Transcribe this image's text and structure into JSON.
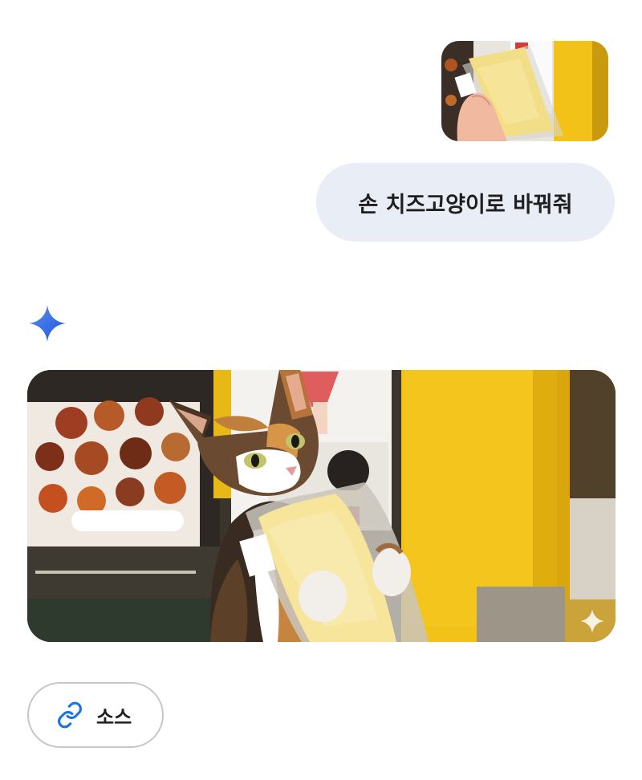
{
  "conversation": {
    "user_prompt": "손 치즈고양이로 바꿔줘",
    "source_label": "소스"
  },
  "icons": {
    "model": "gemini-sparkle-icon",
    "source": "link-icon",
    "watermark": "sparkle-watermark-icon"
  },
  "colors": {
    "bubble_bg": "#e9eef6",
    "sparkle_blue": "#4285f4",
    "link_blue": "#1a73e8",
    "door_yellow": "#f2c218"
  }
}
